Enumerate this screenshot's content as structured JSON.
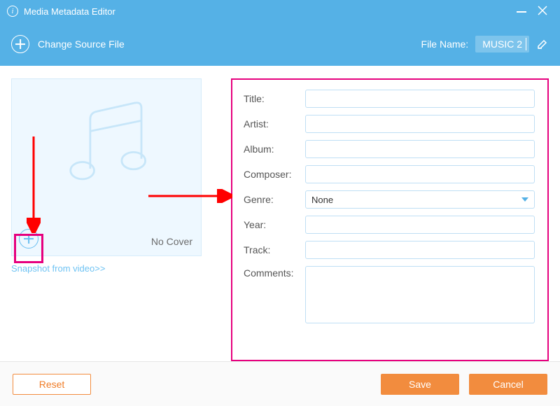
{
  "window": {
    "title": "Media Metadata Editor"
  },
  "toolbar": {
    "change_source_label": "Change Source File",
    "filename_label": "File Name:",
    "filename_value": "MUSIC 2"
  },
  "cover": {
    "no_cover_label": "No Cover",
    "snapshot_link": "Snapshot from video>>"
  },
  "fields": {
    "title": {
      "label": "Title:",
      "value": ""
    },
    "artist": {
      "label": "Artist:",
      "value": ""
    },
    "album": {
      "label": "Album:",
      "value": ""
    },
    "composer": {
      "label": "Composer:",
      "value": ""
    },
    "genre": {
      "label": "Genre:",
      "value": "None"
    },
    "year": {
      "label": "Year:",
      "value": ""
    },
    "track": {
      "label": "Track:",
      "value": ""
    },
    "comments": {
      "label": "Comments:",
      "value": ""
    }
  },
  "buttons": {
    "reset": "Reset",
    "save": "Save",
    "cancel": "Cancel"
  }
}
